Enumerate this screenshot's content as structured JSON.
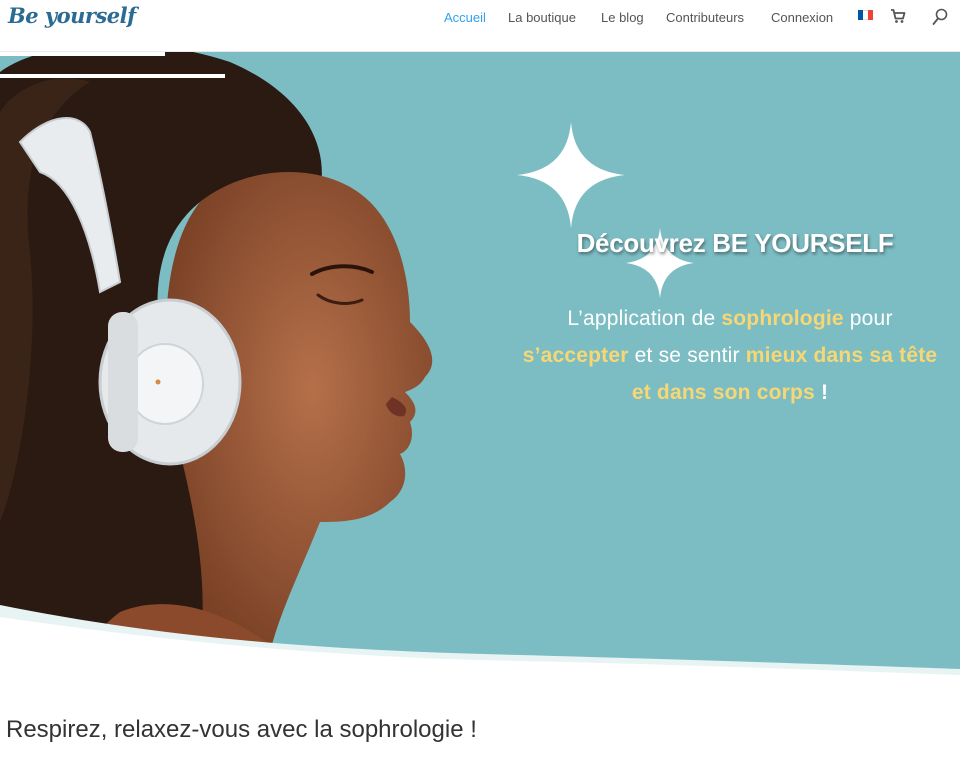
{
  "header": {
    "logo": "Be yourself",
    "nav": [
      {
        "label": "Accueil",
        "active": true
      },
      {
        "label": "La boutique",
        "active": false
      },
      {
        "label": "Le blog",
        "active": false
      },
      {
        "label": "Contributeurs",
        "active": false
      },
      {
        "label": "Connexion",
        "active": false
      }
    ],
    "icons": [
      "flag-fr-icon",
      "cart-icon",
      "search-icon"
    ]
  },
  "hero": {
    "title": "Découvrez BE YOURSELF",
    "text": {
      "part1": "L’application de ",
      "hl1": "sophrologie",
      "part2": " pour ",
      "hl2": "s’accepter",
      "part3": " et se sentir ",
      "hl3": "mieux dans sa tête et dans son corps",
      "part4": " !"
    }
  },
  "subtitle": "Respirez, relaxez-vous avec la sophrologie !",
  "colors": {
    "accent": "#2ea3f2",
    "hero_bg": "#7cbdc4",
    "highlight": "#f7d774",
    "logo": "#2b6a92"
  }
}
